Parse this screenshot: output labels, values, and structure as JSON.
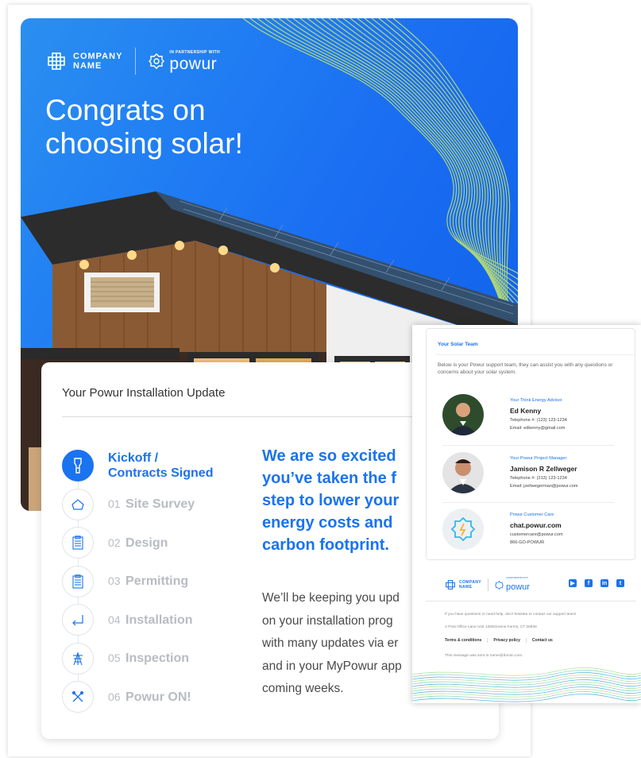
{
  "brand": {
    "company_line1": "COMPANY",
    "company_line2": "NAME",
    "partnership": "IN PARTNERSHIP WITH",
    "powur": "powur"
  },
  "hero": {
    "headline_line1": "Congrats on",
    "headline_line2": "choosing solar!"
  },
  "update": {
    "title": "Your Powur Installation Update",
    "steps": [
      {
        "num": "",
        "label": "Kickoff /",
        "label2": "Contracts Signed",
        "icon": "document-icon",
        "active": true
      },
      {
        "num": "01",
        "label": "Site Survey",
        "icon": "house-icon"
      },
      {
        "num": "02",
        "label": "Design",
        "icon": "clipboard-icon"
      },
      {
        "num": "03",
        "label": "Permitting",
        "icon": "clipboard-icon"
      },
      {
        "num": "04",
        "label": "Installation",
        "icon": "install-arrow-icon"
      },
      {
        "num": "05",
        "label": "Inspection",
        "icon": "tower-icon"
      },
      {
        "num": "06",
        "label": "Powur ON!",
        "icon": "tools-icon"
      }
    ],
    "excited": [
      "We are so excited",
      "you’ve taken the f",
      "step to lower your",
      "energy costs and",
      "carbon footprint."
    ],
    "keeping": [
      "We’ll be keeping you upd",
      "on your installation prog",
      "with many updates via er",
      "and in your MyPowur app",
      "coming weeks."
    ]
  },
  "team": {
    "title": "Your Solar Team",
    "intro": "Below is your Powur support team, they can assist you with any questions or concerns about your solar system.",
    "members": [
      {
        "role": "Your Think Energy Advisor",
        "name": "Ed Kenny",
        "line1": "Telephone #: (123) 123-1234",
        "line2": "Email: edkenny@gmail.com"
      },
      {
        "role": "Your Powur Project Manager",
        "name": "Jamison R Zellweger",
        "line1": "Telephone #: (213) 123-1234",
        "line2": "Email: jzellwegerman@powur.com"
      },
      {
        "role": "Powur Customer Care",
        "name": "chat.powur.com",
        "line1": "customercare@powur.com",
        "line2": "866-GO-POWUR"
      }
    ]
  },
  "footer": {
    "help": "If you have questions or need help, don't hesitate to contact our support team!",
    "address": "A Post Office Lane Unit 1268Greens Farms, CT 06838",
    "links": [
      "Terms & conditions",
      "Privacy policy",
      "Contact us"
    ],
    "sent": "This message was sent to name@domin.com.",
    "social": {
      "youtube": "▶",
      "facebook": "f",
      "linkedin": "in",
      "twitter": "t"
    }
  },
  "colors": {
    "accent": "#1a73ef",
    "muted": "#b8bcc3",
    "hero_gradient_start": "#2a8ff0",
    "wave": "#c9e86a"
  }
}
